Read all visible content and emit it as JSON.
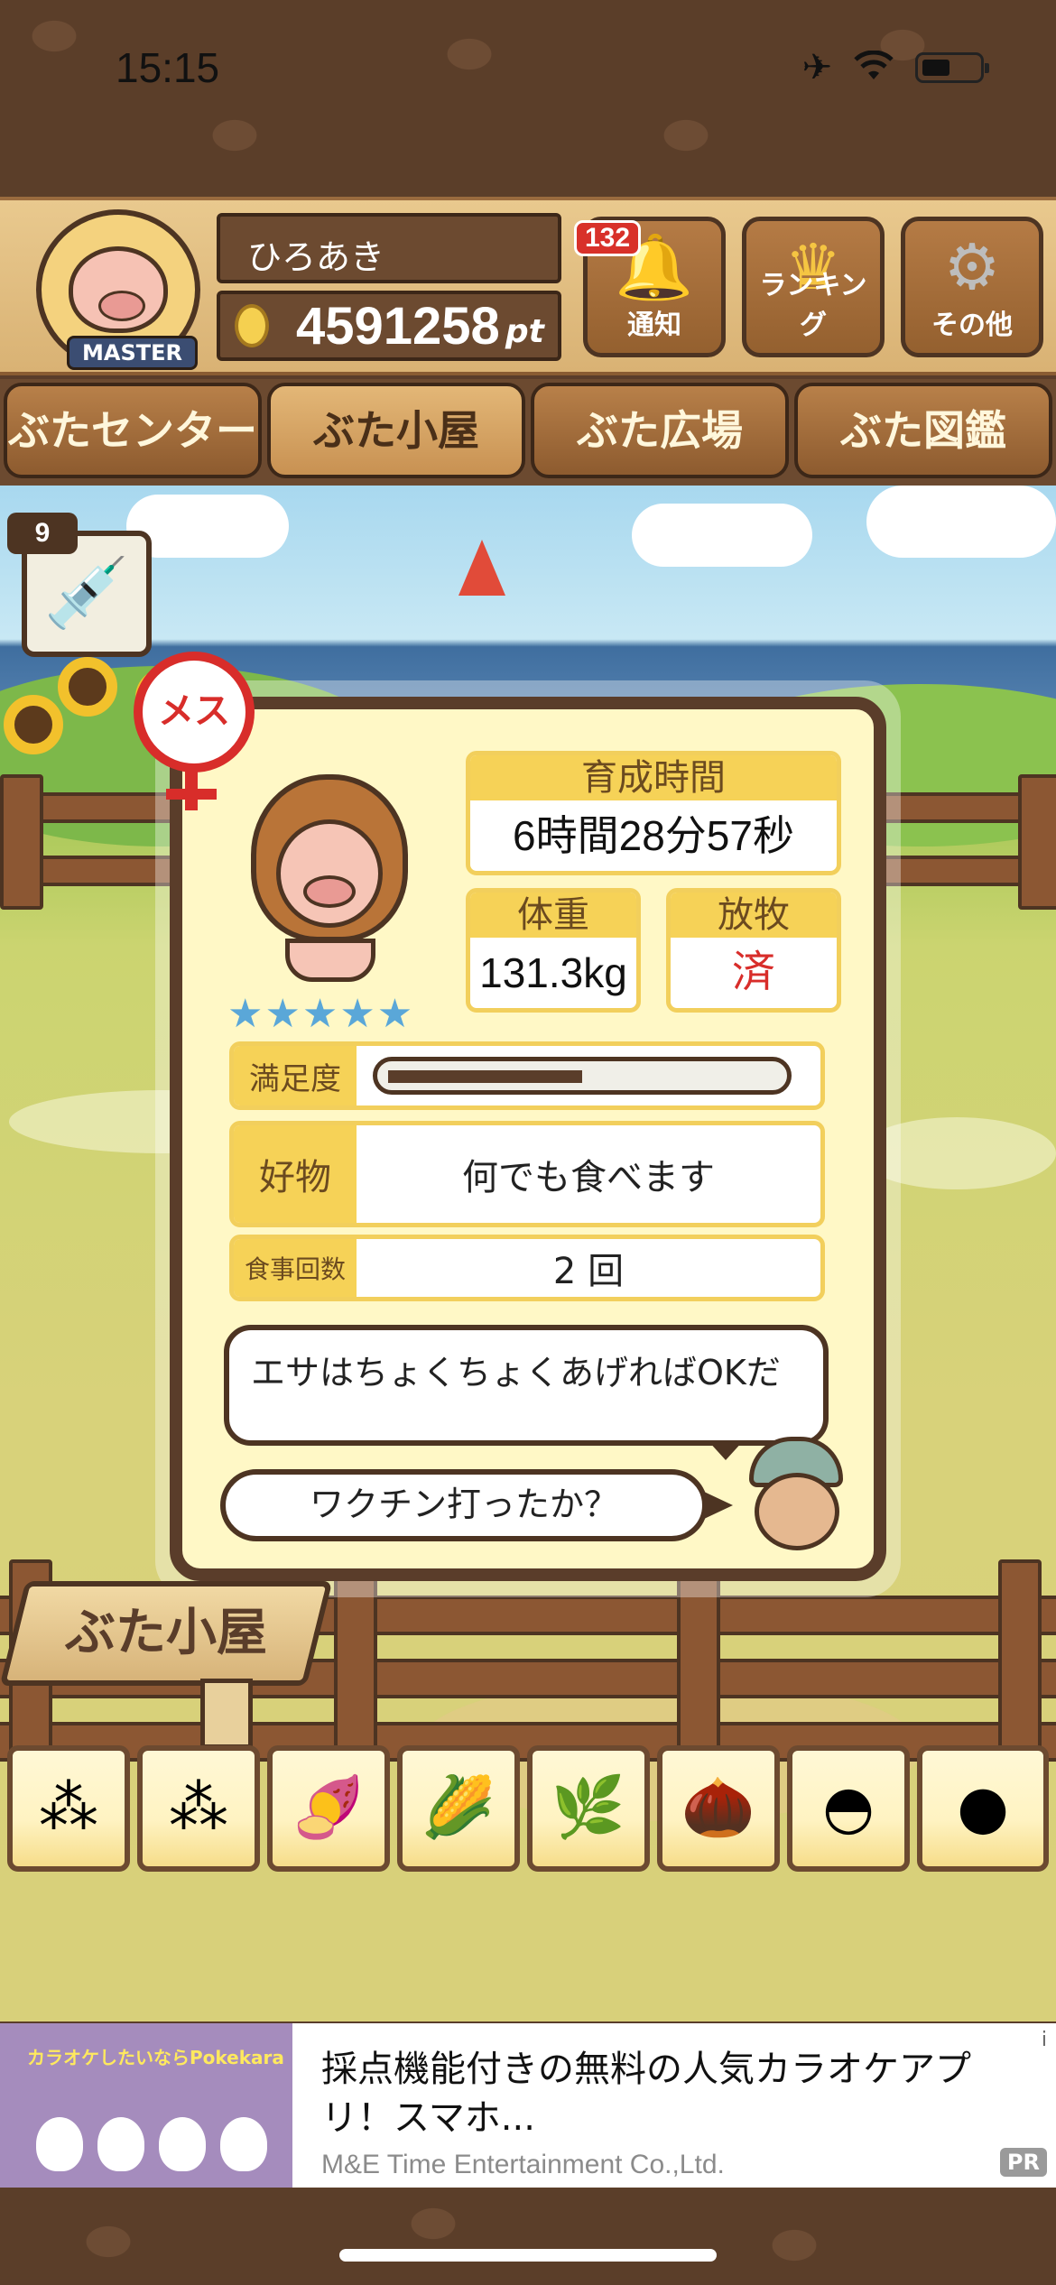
{
  "status_bar": {
    "time": "15:15",
    "icons": [
      "airplane-icon",
      "wifi-icon",
      "battery-icon"
    ]
  },
  "header": {
    "badge_label": "MASTER",
    "user_name": "ひろあき",
    "points_value": "4591258",
    "points_unit": "pt",
    "notification_count": "132",
    "buttons": {
      "notification_label": "通知",
      "ranking_label": "ランキング",
      "other_label": "その他"
    }
  },
  "nav": {
    "tabs": [
      {
        "label": "ぶたセンター",
        "active": false
      },
      {
        "label": "ぶた小屋",
        "active": true
      },
      {
        "label": "ぶた広場",
        "active": false
      },
      {
        "label": "ぶた図鑑",
        "active": false
      }
    ]
  },
  "scene": {
    "syringe_count": "9",
    "sign_label": "ぶた小屋"
  },
  "pig_panel": {
    "gender_label": "メス",
    "stars": "★★★★★",
    "stars_count": 5,
    "raising_time": {
      "label": "育成時間",
      "value": "6時間28分57秒"
    },
    "weight": {
      "label": "体重",
      "value": "131.3kg"
    },
    "grazing": {
      "label": "放牧",
      "value": "済"
    },
    "satisfaction": {
      "label": "満足度",
      "level": 0.5
    },
    "favorite_food": {
      "label": "好物",
      "value": "何でも食べます"
    },
    "meal_count": {
      "label": "食事回数",
      "value": "2 回"
    },
    "speech_tip": "エサはちょくちょくあげればOKだ",
    "speech_question": "ワクチン打ったか？"
  },
  "food_items": [
    {
      "icon": "grain-pile-icon",
      "glyph": "⁂"
    },
    {
      "icon": "seed-pile-icon",
      "glyph": "⁂"
    },
    {
      "icon": "sweet-potato-icon",
      "glyph": "🍠"
    },
    {
      "icon": "corn-icon",
      "glyph": "🌽"
    },
    {
      "icon": "soybean-icon",
      "glyph": "🌿"
    },
    {
      "icon": "acorn-icon",
      "glyph": "🌰"
    },
    {
      "icon": "bean-bowl-icon",
      "glyph": "◓"
    },
    {
      "icon": "meatball-plate-icon",
      "glyph": "●"
    }
  ],
  "ad": {
    "image_text": "カラオケしたいならPokekara",
    "title": "採点機能付きの無料の人気カラオケアプリ！スマホ...",
    "advertiser": "M&E Time Entertainment Co.,Ltd.",
    "pr_label": "PR",
    "info_label": "i"
  },
  "colors": {
    "wood_dark": "#5a3d2a",
    "card_header": "#f6d257",
    "panel_bg": "#fff8c6",
    "accent_red": "#d82d2a",
    "star_blue": "#5aa7d8"
  }
}
